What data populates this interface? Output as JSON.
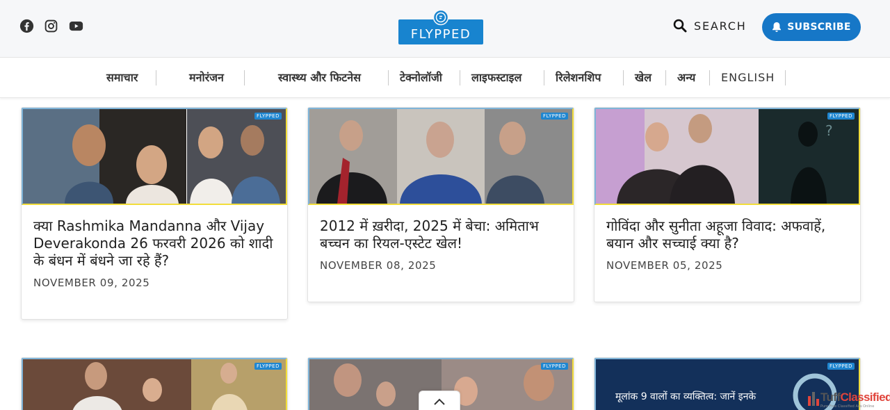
{
  "header": {
    "social": [
      {
        "name": "facebook",
        "icon": "facebook-icon"
      },
      {
        "name": "instagram",
        "icon": "instagram-icon"
      },
      {
        "name": "youtube",
        "icon": "youtube-icon"
      }
    ],
    "logo_text": "FLYPPED",
    "search_label": "SEARCH",
    "subscribe_label": "SUBSCRIBE",
    "accent": "#1677c7"
  },
  "nav": {
    "items": [
      {
        "label": "समाचार"
      },
      {
        "label": "मनोरंजन"
      },
      {
        "label": "स्वास्थ्य और फिटनेस"
      },
      {
        "label": "टेक्नोलॉजी"
      },
      {
        "label": "लाइफस्टाइल"
      },
      {
        "label": "रिलेशनशिप"
      },
      {
        "label": "खेल"
      },
      {
        "label": "अन्य"
      },
      {
        "label": "ENGLISH"
      }
    ]
  },
  "cards": [
    {
      "title": "क्या Rashmika Mandanna और Vijay Deverakonda 26 फरवरी 2026 को शादी के बंधन में बंधने जा रहे हैं?",
      "date": "NOVEMBER 09, 2025",
      "tag": "FLYPPED"
    },
    {
      "title": "2012 में ख़रीदा, 2025 में बेचा: अमिताभ बच्चन का रियल-एस्टेट खेल!",
      "date": "NOVEMBER 08, 2025",
      "tag": "FLYPPED"
    },
    {
      "title": "गोविंदा और सुनीता अहूजा विवाद: अफवाहें, बयान और सच्चाई क्या है?",
      "date": "NOVEMBER 05, 2025",
      "tag": "FLYPPED"
    },
    {
      "title": "",
      "date": "",
      "tag": "FLYPPED"
    },
    {
      "title": "",
      "date": "",
      "tag": "FLYPPED"
    },
    {
      "title": "",
      "date": "",
      "tag": "FLYPPED",
      "image_text": "मूलांक 9 वालों का व्यक्तित्व: जानें इनके"
    }
  ],
  "watermark": {
    "brand_a": "Tuff",
    "brand_b": "Classified",
    "sub": "Pure Free Classified Ads Online"
  }
}
